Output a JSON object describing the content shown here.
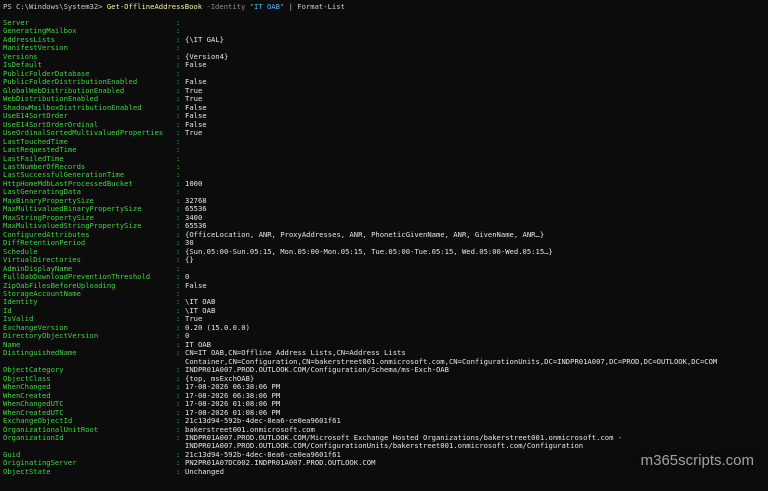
{
  "command": {
    "prompt": "PS C:\\Windows\\System32>",
    "cmdlet": "Get-OfflineAddressBook",
    "param": "-Identity",
    "value": "\"IT OAB\"",
    "pipe": "| Format-List"
  },
  "separator": ":",
  "properties": [
    {
      "key": "Server",
      "value": ""
    },
    {
      "key": "GeneratingMailbox",
      "value": ""
    },
    {
      "key": "AddressLists",
      "value": "{\\IT GAL}"
    },
    {
      "key": "ManifestVersion",
      "value": ""
    },
    {
      "key": "Versions",
      "value": "{Version4}"
    },
    {
      "key": "IsDefault",
      "value": "False"
    },
    {
      "key": "PublicFolderDatabase",
      "value": ""
    },
    {
      "key": "PublicFolderDistributionEnabled",
      "value": "False"
    },
    {
      "key": "GlobalWebDistributionEnabled",
      "value": "True"
    },
    {
      "key": "WebDistributionEnabled",
      "value": "True"
    },
    {
      "key": "ShadowMailboxDistributionEnabled",
      "value": "False"
    },
    {
      "key": "UseE14SortOrder",
      "value": "False"
    },
    {
      "key": "UseE14SortOrderOrdinal",
      "value": "False"
    },
    {
      "key": "UseOrdinalSortedMultivaluedProperties",
      "value": "True"
    },
    {
      "key": "LastTouchedTime",
      "value": ""
    },
    {
      "key": "LastRequestedTime",
      "value": ""
    },
    {
      "key": "LastFailedTime",
      "value": ""
    },
    {
      "key": "LastNumberOfRecords",
      "value": ""
    },
    {
      "key": "LastSuccessfulGenerationTime",
      "value": ""
    },
    {
      "key": "HttpHomeMdbLastProcessedBucket",
      "value": "1000"
    },
    {
      "key": "LastGeneratingData",
      "value": ""
    },
    {
      "key": "MaxBinaryPropertySize",
      "value": "32768"
    },
    {
      "key": "MaxMultivaluedBinaryPropertySize",
      "value": "65536"
    },
    {
      "key": "MaxStringPropertySize",
      "value": "3400"
    },
    {
      "key": "MaxMultivaluedStringPropertySize",
      "value": "65536"
    },
    {
      "key": "ConfiguredAttributes",
      "value": "{OfficeLocation, ANR, ProxyAddresses, ANR, PhoneticGivenName, ANR, GivenName, ANR…}"
    },
    {
      "key": "DiffRetentionPeriod",
      "value": "30"
    },
    {
      "key": "Schedule",
      "value": "{Sun.05:00-Sun.05:15, Mon.05:00-Mon.05:15, Tue.05:00-Tue.05:15, Wed.05:00-Wed.05:15…}"
    },
    {
      "key": "VirtualDirectories",
      "value": "{}"
    },
    {
      "key": "AdminDisplayName",
      "value": ""
    },
    {
      "key": "FullOabDownloadPreventionThreshold",
      "value": "0"
    },
    {
      "key": "ZipOabFilesBeforeUploading",
      "value": "False"
    },
    {
      "key": "StorageAccountName",
      "value": ""
    },
    {
      "key": "Identity",
      "value": "\\IT OAB"
    },
    {
      "key": "Id",
      "value": "\\IT OAB"
    },
    {
      "key": "IsValid",
      "value": "True"
    },
    {
      "key": "ExchangeVersion",
      "value": "0.20 (15.0.0.0)"
    },
    {
      "key": "DirectoryObjectVersion",
      "value": "0"
    },
    {
      "key": "Name",
      "value": "IT OAB"
    },
    {
      "key": "DistinguishedName",
      "value": "CN=IT OAB,CN=Offline Address Lists,CN=Address Lists\nContainer,CN=Configuration,CN=bakerstreet001.onmicrosoft.com,CN=ConfigurationUnits,DC=INDPR01A007,DC=PROD,DC=OUTLOOK,DC=COM"
    },
    {
      "key": "ObjectCategory",
      "value": "INDPR01A007.PROD.OUTLOOK.COM/Configuration/Schema/ms-Exch-OAB"
    },
    {
      "key": "ObjectClass",
      "value": "{top, msExchOAB}"
    },
    {
      "key": "WhenChanged",
      "value": "17-08-2026 06:38:06 PM"
    },
    {
      "key": "WhenCreated",
      "value": "17-08-2026 06:38:06 PM"
    },
    {
      "key": "WhenChangedUTC",
      "value": "17-08-2026 01:08:06 PM"
    },
    {
      "key": "WhenCreatedUTC",
      "value": "17-08-2026 01:08:06 PM"
    },
    {
      "key": "ExchangeObjectId",
      "value": "21c13d94-592b-4dec-8ea6-ce0ea9601f61"
    },
    {
      "key": "OrganizationalUnitRoot",
      "value": "bakerstreet001.onmicrosoft.com"
    },
    {
      "key": "OrganizationId",
      "value": "INDPR01A007.PROD.OUTLOOK.COM/Microsoft Exchange Hosted Organizations/bakerstreet001.onmicrosoft.com -\nINDPR01A007.PROD.OUTLOOK.COM/ConfigurationUnits/bakerstreet001.onmicrosoft.com/Configuration"
    },
    {
      "key": "Guid",
      "value": "21c13d94-592b-4dec-8ea6-ce0ea9601f61"
    },
    {
      "key": "OriginatingServer",
      "value": "PN2PR01A07DC002.INDPR01A007.PROD.OUTLOOK.COM"
    },
    {
      "key": "ObjectState",
      "value": "Unchanged"
    }
  ],
  "watermark": "m365scripts.com",
  "colors": {
    "background": "#0c0c0c",
    "property_name": "#3fd43f",
    "property_value": "#e6e6e6",
    "cmdlet": "#f9f1a5",
    "string": "#58b6f0"
  }
}
